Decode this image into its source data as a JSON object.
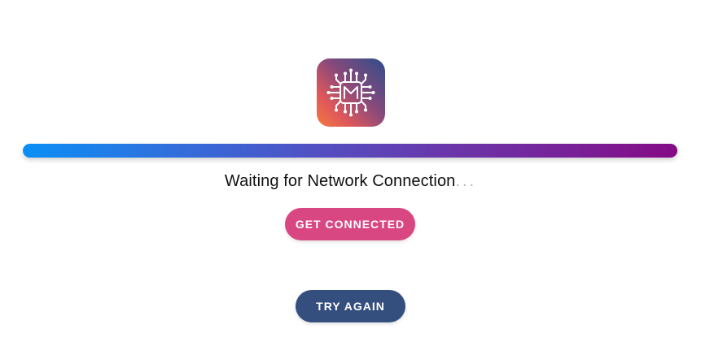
{
  "app": {
    "logo_icon": "circuit-chip-icon",
    "logo_gradient": [
      "#f27a3e",
      "#e0585a",
      "#8a4a7a",
      "#2f4d8c"
    ]
  },
  "progress": {
    "fraction": 1.0,
    "gradient_colors": [
      "#0a8ff5",
      "#5250c2",
      "#860a86"
    ]
  },
  "status": {
    "message": "Waiting for Network Connection",
    "dots": "..."
  },
  "actions": {
    "get_connected_label": "GET CONNECTED",
    "get_connected_color": "#d84782",
    "try_again_label": "TRY AGAIN",
    "try_again_color": "#344f7e"
  }
}
